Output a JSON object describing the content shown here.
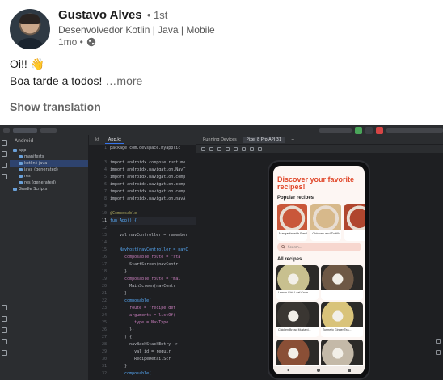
{
  "post": {
    "author_name": "Gustavo Alves",
    "connection_degree": "• 1st",
    "headline": "Desenvolvedor Kotlin | Java | Mobile",
    "posted_ago": "1mo •",
    "greeting": "Oi!! 👋",
    "body": "Boa tarde a todos!",
    "see_more": "…more",
    "show_translation": "Show translation"
  },
  "ide": {
    "project_view": "Android",
    "tree": [
      {
        "label": "app",
        "indent": 0
      },
      {
        "label": "manifests",
        "indent": 1
      },
      {
        "label": "kotlin+java",
        "indent": 1
      },
      {
        "label": "java (generated)",
        "indent": 1
      },
      {
        "label": "res",
        "indent": 1
      },
      {
        "label": "res (generated)",
        "indent": 1
      },
      {
        "label": "Gradle Scripts",
        "indent": 0
      }
    ],
    "editor_tab": "App.kt",
    "line_numbers": [
      "1",
      "",
      "3",
      "4",
      "5",
      "6",
      "7",
      "8",
      "9",
      "10",
      "11",
      "12",
      "13",
      "14",
      "15",
      "16",
      "17",
      "18",
      "19",
      "20",
      "21",
      "22",
      "23",
      "24",
      "25",
      "26",
      "27",
      "28",
      "29",
      "30",
      "31",
      "32"
    ],
    "code_lines": [
      "package com.devspace.myapplic",
      "",
      "import androidx.compose.runtime",
      "import androidx.navigation.NavT",
      "import androidx.navigation.comp",
      "import androidx.navigation.comp",
      "import androidx.navigation.comp",
      "import androidx.navigation.navA",
      "",
      "@Composable",
      "fun App() {",
      "",
      "    val navController = remember",
      "",
      "    NavHost(navController = navC",
      "      composable(route = \"sta",
      "        StartScreen(navContr",
      "      }",
      "      composable(route = \"mai",
      "        MainScreen(navContr",
      "      }",
      "      composable(",
      "        route = \"recipe_det",
      "        arguments = listOf(",
      "          type = NavType.",
      "        })",
      "      ) {",
      "        navBackStackEntry ->",
      "          val id = requir",
      "          RecipeDetailScr",
      "      }",
      "      composable("
    ],
    "running_devices_tab": "Running Devices",
    "device_tab": "Pixel 8 Pro API 31"
  },
  "app": {
    "title": "Discover your favorite recipes!",
    "popular_heading": "Popular recipes",
    "popular": [
      {
        "label": "Margarita with Basil an...",
        "color": "#c9573a"
      },
      {
        "label": "Chicken and Tortilla Bo...",
        "color": "#d7b98b"
      },
      {
        "label": "",
        "color": "#b0462e"
      }
    ],
    "search_placeholder": "Search...",
    "all_heading": "All recipes",
    "all": [
      {
        "label": "Lemon Chia Loaf Crum...",
        "color": "#c8c08f"
      },
      {
        "label": "",
        "color": "#6e5845"
      },
      {
        "label": "Chicken Bread Mustard...",
        "color": "#3a3632"
      },
      {
        "label": "Turmeric Ginger Tea...",
        "color": "#d9c37a"
      },
      {
        "label": "",
        "color": "#8a4f36"
      },
      {
        "label": "",
        "color": "#c4b9a8"
      }
    ]
  },
  "colors": {
    "ide_bg": "#1e1f22",
    "ide_panel": "#2b2d30",
    "app_accent": "#e0482b",
    "app_bg": "#fdf6f3"
  }
}
